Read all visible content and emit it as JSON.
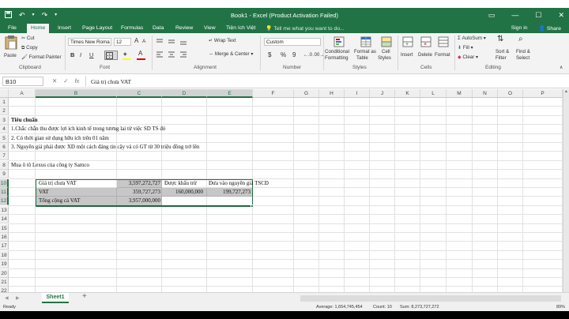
{
  "window": {
    "title": "Book1 - Excel (Product Activation Failed)"
  },
  "qat": {
    "save_icon": "save-icon",
    "undo_icon": "undo-icon",
    "redo_icon": "redo-icon",
    "customize_icon": "chevron-down-icon"
  },
  "window_controls": {
    "ribbon_opts": "▭",
    "min": "—",
    "max": "☐",
    "close": "✕"
  },
  "tabs": [
    {
      "label": "File"
    },
    {
      "label": "Home"
    },
    {
      "label": "Insert"
    },
    {
      "label": "Page Layout"
    },
    {
      "label": "Formulas"
    },
    {
      "label": "Data"
    },
    {
      "label": "Review"
    },
    {
      "label": "View"
    },
    {
      "label": "Tiện ích Việt"
    }
  ],
  "tell_me": "Tell me what you want to do...",
  "signin": "Sign in",
  "share": "Share",
  "ribbon": {
    "clipboard": {
      "paste": "Paste",
      "cut": "Cut",
      "copy": "Copy",
      "format_painter": "Format Painter",
      "label": "Clipboard"
    },
    "font": {
      "name": "Times New Roma",
      "size": "12",
      "bold": "B",
      "italic": "I",
      "underline": "U",
      "grow": "A",
      "shrink": "A",
      "color_letter": "A",
      "label": "Font"
    },
    "alignment": {
      "wrap": "Wrap Text",
      "merge": "Merge & Center",
      "label": "Alignment"
    },
    "number": {
      "format": "Custom",
      "currency": "$",
      "percent": "%",
      "comma": "9",
      "label": "Number"
    },
    "styles": {
      "conditional": [
        "Conditional",
        "Formatting"
      ],
      "table": [
        "Format as",
        "Table"
      ],
      "cell": [
        "Cell",
        "Styles"
      ],
      "label": "Styles"
    },
    "cells": {
      "insert": "Insert",
      "delete": "Delete",
      "format": "Format",
      "label": "Cells"
    },
    "editing": {
      "autosum": "AutoSum",
      "fill": "Fill",
      "clear": "Clear",
      "sort": [
        "Sort &",
        "Filter"
      ],
      "find": [
        "Find &",
        "Select"
      ],
      "label": "Editing"
    }
  },
  "formula_bar": {
    "name_box": "B10",
    "cancel": "✕",
    "enter": "✓",
    "fx": "fx",
    "content": "Giá trị chưa VAT"
  },
  "columns": [
    "A",
    "B",
    "C",
    "D",
    "E",
    "F",
    "G",
    "H",
    "I",
    "J",
    "K",
    "L",
    "M",
    "N",
    "O",
    "P"
  ],
  "rows": [
    "1",
    "2",
    "3",
    "4",
    "5",
    "6",
    "7",
    "8",
    "9",
    "10",
    "11",
    "12",
    "13",
    "14",
    "15",
    "16",
    "17",
    "18",
    "19",
    "20",
    "21",
    "22"
  ],
  "cells": {
    "r3": "Tiêu chuẩn",
    "r4": "1.Chắc chắn thu được lợi ích kinh tế trong tương lai từ việc SD TS đó",
    "r5": "2. Có thời gian sử dụng hữu ích trên 01 năm",
    "r6": "3. Nguyên giá phải được XĐ một cách đáng tin cậy và có GT từ 30 triệu đồng trở lên",
    "r8": "Mua ô tô Lexus của công ty Samco",
    "b10": "Giá trị chưa VAT",
    "c10": "3,597,272,727",
    "d10": "Được khấu trừ",
    "e10": "Đưa vào nguyên giá TSCĐ",
    "b11": "VAT",
    "c11": "359,727,273",
    "d11": "160,000,000",
    "e11": "199,727,273",
    "b12": "Tổng cộng cả VAT",
    "c12": "3,957,000,000"
  },
  "sheet_tab": "Sheet1",
  "add_sheet": "+",
  "status": {
    "ready": "Ready",
    "average": "Average: 1,654,745,454",
    "count": "Count: 10",
    "sum": "Sum: 8,273,727,272",
    "zoom": "89%"
  }
}
